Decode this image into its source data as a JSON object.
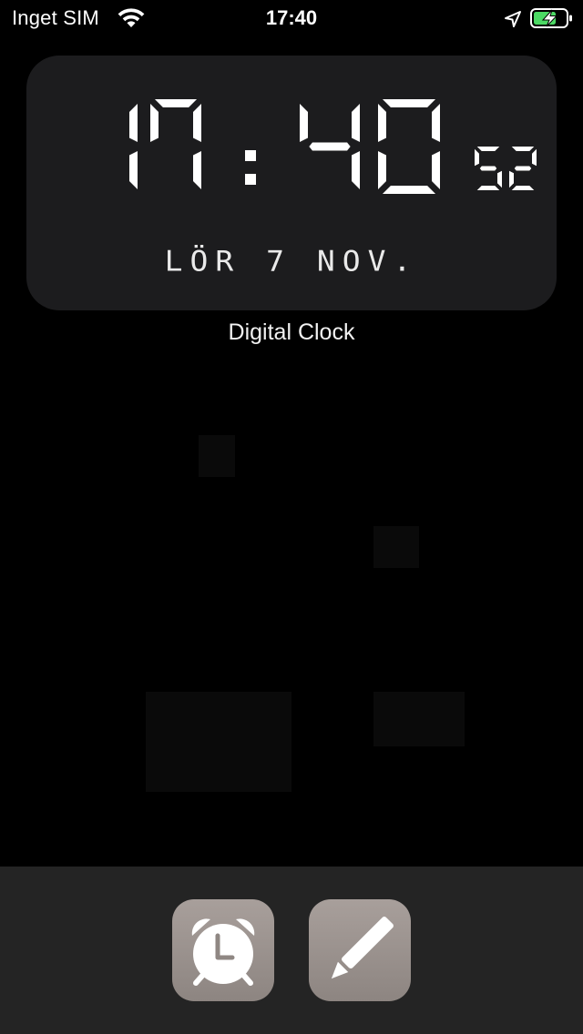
{
  "status_bar": {
    "carrier": "Inget SIM",
    "time": "17:40",
    "icons": [
      "wifi-icon",
      "location-arrow-icon",
      "battery-charging-icon"
    ],
    "battery_color": "#4cd964"
  },
  "widget": {
    "hours": "17",
    "separator": ":",
    "minutes": "40",
    "seconds": "52",
    "date": "LÖR 7 NOV.",
    "label": "Digital Clock",
    "background": "#1c1c1e"
  },
  "dock": {
    "apps": [
      {
        "name": "Alarm",
        "icon": "alarm-clock-icon"
      },
      {
        "name": "Notes",
        "icon": "pencil-icon"
      }
    ]
  }
}
